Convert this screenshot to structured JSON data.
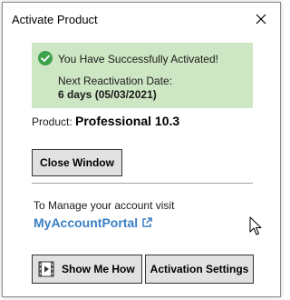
{
  "window": {
    "title": "Activate Product",
    "close_icon": "close-icon"
  },
  "status": {
    "message": "You Have Successfully Activated!",
    "icon": "check-circle-icon",
    "background_color": "#cde6c3",
    "icon_color": "#3ea24a",
    "reactivation_label": "Next Reactivation Date:",
    "reactivation_value": "6 days (05/03/2021)"
  },
  "product": {
    "label": "Product:",
    "value": "Professional 10.3"
  },
  "buttons": {
    "close_window": "Close Window",
    "show_me_how": "Show Me How",
    "show_me_how_icon": "film-icon",
    "activation_settings": "Activation Settings"
  },
  "account": {
    "manage_text": "To Manage your account visit",
    "portal_link": "MyAccountPortal",
    "link_icon": "external-link-icon",
    "link_color": "#3a7fc4"
  }
}
